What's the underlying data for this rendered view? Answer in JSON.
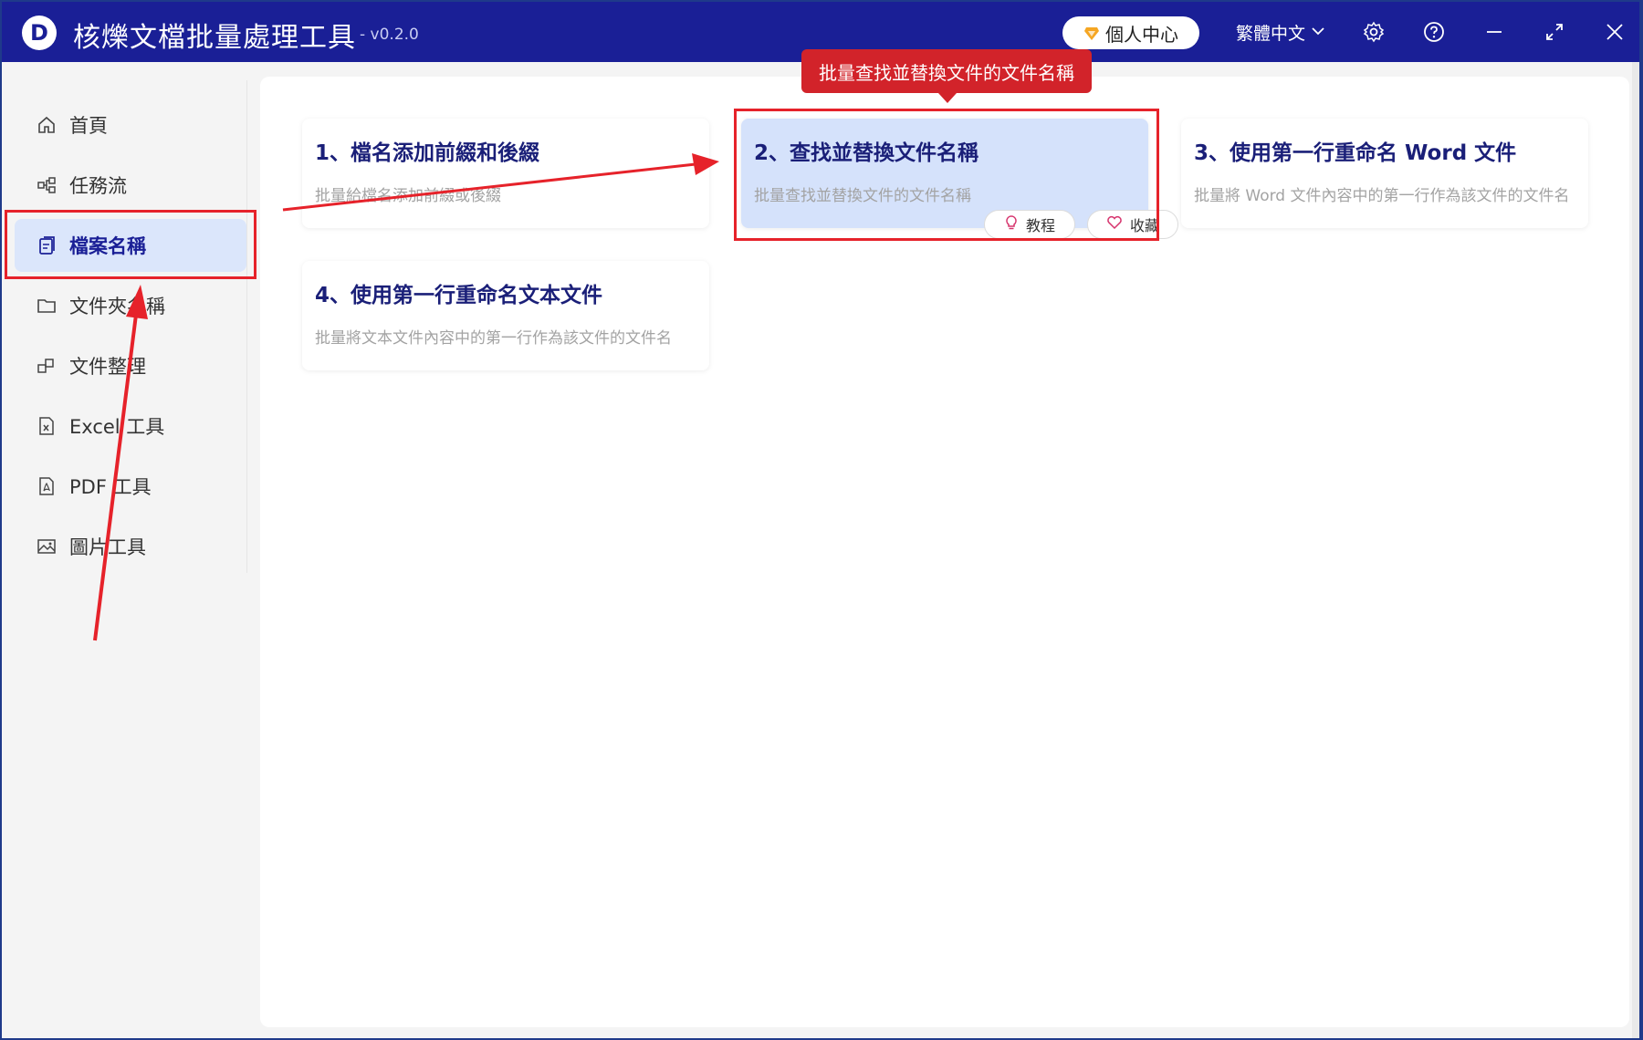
{
  "app": {
    "logo_letter": "D",
    "title": "核爍文檔批量處理工具",
    "version": "- v0.2.0"
  },
  "header": {
    "user_center_label": "個人中心",
    "language_label": "繁體中文"
  },
  "sidebar": {
    "items": [
      {
        "label": "首頁",
        "icon": "home-icon"
      },
      {
        "label": "任務流",
        "icon": "workflow-icon"
      },
      {
        "label": "檔案名稱",
        "icon": "file-name-icon",
        "active": true
      },
      {
        "label": "文件夾名稱",
        "icon": "folder-icon"
      },
      {
        "label": "文件整理",
        "icon": "organize-icon"
      },
      {
        "label": "Excel 工具",
        "icon": "excel-icon"
      },
      {
        "label": "PDF 工具",
        "icon": "pdf-icon"
      },
      {
        "label": "圖片工具",
        "icon": "image-icon"
      }
    ]
  },
  "main": {
    "cards": [
      {
        "title": "1、檔名添加前綴和後綴",
        "desc": "批量給檔名添加前綴或後綴"
      },
      {
        "title": "2、查找並替換文件名稱",
        "desc": "批量查找並替換文件的文件名稱"
      },
      {
        "title": "3、使用第一行重命名 Word 文件",
        "desc": "批量將 Word 文件內容中的第一行作為該文件的文件名"
      },
      {
        "title": "4、使用第一行重命名文本文件",
        "desc": "批量將文本文件內容中的第一行作為該文件的文件名"
      }
    ],
    "tutorial_label": "教程",
    "favorite_label": "收藏",
    "tooltip": "批量查找並替換文件的文件名稱"
  },
  "colors": {
    "titlebar": "#1a1f96",
    "active_bg": "#dbe6fb",
    "highlight": "#e6222a"
  }
}
